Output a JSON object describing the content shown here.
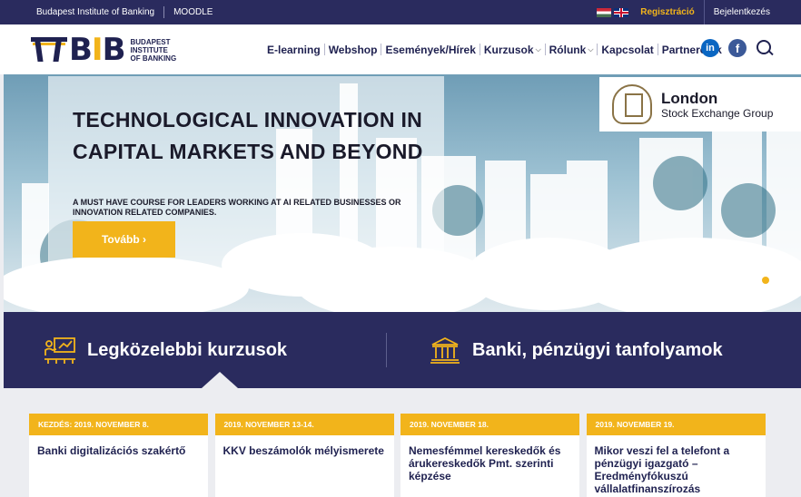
{
  "topbar": {
    "org": "Budapest Institute of Banking",
    "moodle": "MOODLE",
    "register": "Regisztráció",
    "login": "Bejelentkezés"
  },
  "logo": {
    "word": "BIB",
    "sub_line1": "BUDAPEST",
    "sub_line2": "INSTITUTE",
    "sub_line3": "OF BANKING"
  },
  "menu": [
    {
      "label": "E-learning",
      "dropdown": false
    },
    {
      "label": "Webshop",
      "dropdown": false
    },
    {
      "label": "Események/Hírek",
      "dropdown": false
    },
    {
      "label": "Kurzusok",
      "dropdown": true
    },
    {
      "label": "Rólunk",
      "dropdown": true
    },
    {
      "label": "Kapcsolat",
      "dropdown": false
    },
    {
      "label": "Partnereink",
      "dropdown": false
    }
  ],
  "social": {
    "linkedin": "in",
    "facebook": "f"
  },
  "hero": {
    "title": "TECHNOLOGICAL INNOVATION IN CAPITAL MARKETS AND BEYOND",
    "lead": "A MUST HAVE COURSE FOR LEADERS WORKING AT AI RELATED BUSINESSES OR INNOVATION RELATED COMPANIES.",
    "cta": "Tovább ›",
    "partner_line1": "London",
    "partner_line2": "Stock Exchange Group",
    "slides": 4,
    "active_slide": 4
  },
  "tabs": [
    {
      "label": "Legközelebbi kurzusok",
      "icon": "presentation-icon",
      "active": true
    },
    {
      "label": "Banki, pénzügyi tanfolyamok",
      "icon": "bank-building-icon",
      "active": false
    }
  ],
  "cards": [
    {
      "date": "KEZDÉS: 2019. NOVEMBER 8.",
      "title": "Banki digitalizációs szakértő"
    },
    {
      "date": "2019. NOVEMBER 13-14.",
      "title": "KKV beszámolók mélyismerete"
    },
    {
      "date": "2019. NOVEMBER 18.",
      "title": "Nemesfémmel kereskedők és árukereskedők Pmt. szerinti képzése"
    },
    {
      "date": "2019. NOVEMBER 19.",
      "title": "Mikor veszi fel a telefont a pénzügyi igazgató – Eredményfókuszú vállalatfinanszírozás"
    }
  ],
  "colors": {
    "navy": "#2a2b5e",
    "gold": "#f2b41b",
    "bg": "#ecedf1"
  }
}
